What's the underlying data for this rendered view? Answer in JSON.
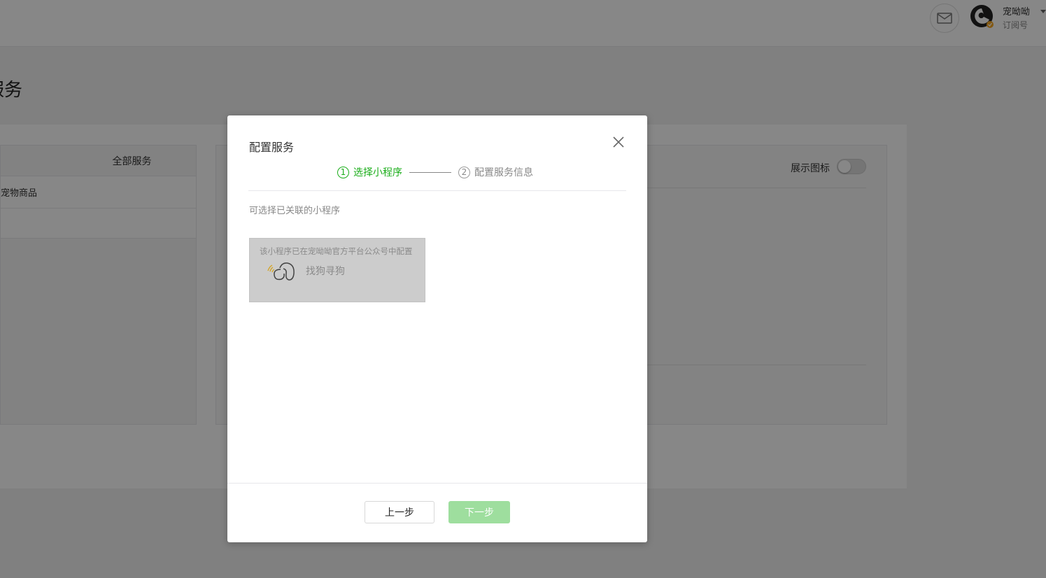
{
  "topbar": {
    "account_name": "宠呦呦",
    "account_type": "订阅号",
    "mail_icon": "mail-icon",
    "avatar_icon": "avatar"
  },
  "page": {
    "title": "服务"
  },
  "left_list": {
    "header": "全部服务",
    "items": [
      "宠物商品"
    ]
  },
  "right_panel": {
    "icon_label": "展示图标",
    "icon_switch_on": false
  },
  "modal": {
    "title": "配置服务",
    "steps": [
      {
        "num": "1",
        "label": "选择小程序",
        "state": "active"
      },
      {
        "num": "2",
        "label": "配置服务信息",
        "state": "inactive"
      }
    ],
    "hint": "可选择已关联的小程序",
    "app_card": {
      "note": "该小程序已在宠呦呦官方平台公众号中配置",
      "name": "找狗寻狗",
      "logo_icon": "dog-logo-icon"
    },
    "prev_label": "上一步",
    "next_label": "下一步"
  },
  "colors": {
    "accent": "#1aad19",
    "next_disabled": "#9ede9e",
    "overlay": "rgba(0,0,0,0.47)"
  }
}
